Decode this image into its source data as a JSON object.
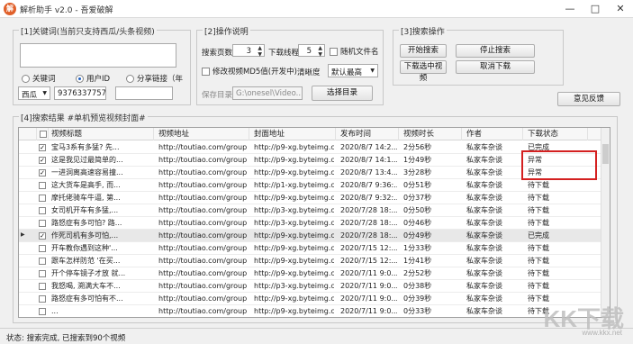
{
  "window": {
    "title": "解析助手 v2.0 - 吾爱破解",
    "app_icon": "解",
    "minimize": "—",
    "maximize": "□",
    "close": "✕"
  },
  "keywords": {
    "legend": "[1]关键词(当前只支持西瓜/头条视频)",
    "textarea_value": "",
    "radios": [
      {
        "label": "关键词",
        "checked": false
      },
      {
        "label": "用户ID",
        "checked": true
      },
      {
        "label": "分享链接（年",
        "checked": false
      }
    ],
    "platform": "西瓜",
    "user_id": "93763377576",
    "extra_value": ""
  },
  "operation": {
    "legend": "[2]操作说明",
    "pages_label": "搜索页数",
    "pages_value": "3",
    "threads_label": "下载线程",
    "threads_value": "5",
    "random_filename": "随机文件名",
    "modify_md5": "修改视频MD5值(开发中)",
    "quality_label": "清晰度",
    "quality_value": "默认最高",
    "save_dir_label": "保存目录",
    "save_dir_value": "G:\\onesel\\Video...",
    "select_dir_button": "选择目录"
  },
  "search_ops": {
    "legend": "[3]搜索操作",
    "start_search": "开始搜索",
    "stop_search": "停止搜索",
    "download_selected": "下载选中视频",
    "cancel_download": "取消下载",
    "feedback": "意见反馈"
  },
  "results": {
    "legend": "[4]搜索结果 #单机预览视频封面#",
    "columns": [
      "视频标题",
      "视频地址",
      "封面地址",
      "发布时间",
      "视频时长",
      "作者",
      "下载状态"
    ],
    "rows": [
      {
        "checked": true,
        "title": "宝马3系有多猛? 先...",
        "url": "http://toutiao.com/group...",
        "cover": "http://p9-xg.byteimg.c...",
        "time": "2020/8/7 14:2...",
        "duration": "2分56秒",
        "author": "私家车杂谈",
        "status": "已完成",
        "selected": false
      },
      {
        "checked": true,
        "title": "这是我见过最简单的...",
        "url": "http://toutiao.com/group...",
        "cover": "http://p9-xg.byteimg.c...",
        "time": "2020/8/7 14:1...",
        "duration": "1分49秒",
        "author": "私家车杂谈",
        "status": "异常",
        "selected": false
      },
      {
        "checked": true,
        "title": "一进洞离高速容易撞...",
        "url": "http://toutiao.com/group...",
        "cover": "http://p9-xg.byteimg.c...",
        "time": "2020/8/7 13:4...",
        "duration": "3分28秒",
        "author": "私家车杂谈",
        "status": "异常",
        "selected": false
      },
      {
        "checked": false,
        "title": "这大货车是高手, 而...",
        "url": "http://toutiao.com/group...",
        "cover": "http://p1-xg.byteimg.c...",
        "time": "2020/8/7 9:36:...",
        "duration": "0分51秒",
        "author": "私家车杂谈",
        "status": "待下载",
        "selected": false
      },
      {
        "checked": false,
        "title": "摩托佬骑车牛逼, 第...",
        "url": "http://toutiao.com/group...",
        "cover": "http://p9-xg.byteimg.c...",
        "time": "2020/8/7 9:32:...",
        "duration": "0分37秒",
        "author": "私家车杂谈",
        "status": "待下载",
        "selected": false
      },
      {
        "checked": false,
        "title": "女司机开车有多猛,...",
        "url": "http://toutiao.com/group...",
        "cover": "http://p3-xg.byteimg.c...",
        "time": "2020/7/28 18:...",
        "duration": "0分50秒",
        "author": "私家车杂谈",
        "status": "待下载",
        "selected": false
      },
      {
        "checked": false,
        "title": "路怒症有多可怕? 路...",
        "url": "http://toutiao.com/group...",
        "cover": "http://p3-xg.byteimg.c...",
        "time": "2020/7/28 18:...",
        "duration": "0分46秒",
        "author": "私家车杂谈",
        "status": "待下载",
        "selected": false
      },
      {
        "checked": true,
        "title": "作死司机有多可怕,...",
        "url": "http://toutiao.com/group...",
        "cover": "http://p9-xg.byteimg.c...",
        "time": "2020/7/28 18:...",
        "duration": "0分49秒",
        "author": "私家车杂谈",
        "status": "已完成",
        "selected": true
      },
      {
        "checked": false,
        "title": "开车教你遇到这种'...",
        "url": "http://toutiao.com/group...",
        "cover": "http://p9-xg.byteimg.c...",
        "time": "2020/7/15 12:...",
        "duration": "1分33秒",
        "author": "私家车杂谈",
        "status": "待下载",
        "selected": false
      },
      {
        "checked": false,
        "title": "跟车怎样防范 '在买...",
        "url": "http://toutiao.com/group...",
        "cover": "http://p9-xg.byteimg.c...",
        "time": "2020/7/15 12:...",
        "duration": "1分41秒",
        "author": "私家车杂谈",
        "status": "待下载",
        "selected": false
      },
      {
        "checked": false,
        "title": "开个停车镜子才放 就...",
        "url": "http://toutiao.com/group...",
        "cover": "http://p9-xg.byteimg.c...",
        "time": "2020/7/11 9:0...",
        "duration": "2分52秒",
        "author": "私家车杂谈",
        "status": "待下载",
        "selected": false
      },
      {
        "checked": false,
        "title": "我怒喝, 溯满大车不...",
        "url": "http://toutiao.com/group...",
        "cover": "http://p3-xg.byteimg.c...",
        "time": "2020/7/11 9:0...",
        "duration": "0分38秒",
        "author": "私家车杂谈",
        "status": "待下载",
        "selected": false
      },
      {
        "checked": false,
        "title": "路怒症有多可怕有不...",
        "url": "http://toutiao.com/group...",
        "cover": "http://p9-xg.byteimg.c...",
        "time": "2020/7/11 9:0...",
        "duration": "0分39秒",
        "author": "私家车杂谈",
        "status": "待下载",
        "selected": false
      },
      {
        "checked": false,
        "title": "...",
        "url": "http://toutiao.com/group...",
        "cover": "http://p9-xg.byteimg.c...",
        "time": "2020/7/11 9:0...",
        "duration": "0分33秒",
        "author": "私家车杂谈",
        "status": "待下载",
        "selected": false
      }
    ]
  },
  "status_bar": {
    "text": "状态: 搜索完成, 已搜索到90个视频"
  },
  "watermark": {
    "text": "KK下载",
    "url": "www.kkx.net"
  }
}
